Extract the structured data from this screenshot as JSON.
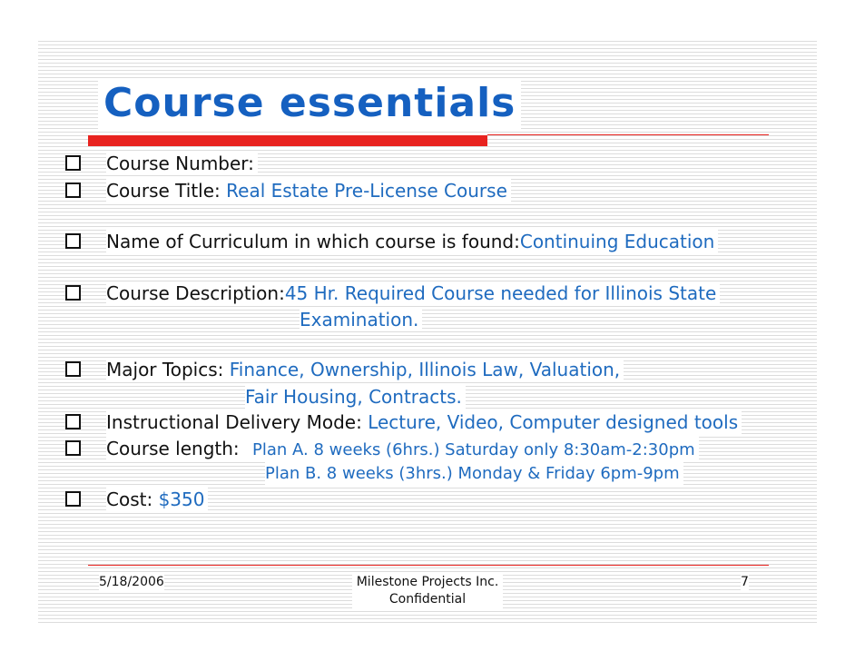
{
  "slide": {
    "title": "Course essentials",
    "items": {
      "course_number": {
        "label": "Course Number:",
        "value": ""
      },
      "course_title": {
        "label": "Course Title:",
        "value": "Real Estate Pre-License Course"
      },
      "curriculum": {
        "label": "Name of Curriculum in which course is found:",
        "value": "Continuing Education"
      },
      "description": {
        "label": "Course Description:",
        "value_line1": "45 Hr. Required Course needed for Illinois  State",
        "value_line2": "Examination."
      },
      "major_topics": {
        "label": "Major Topics:",
        "value_line1": "Finance, Ownership, Illinois Law, Valuation,",
        "value_line2": "Fair Housing, Contracts."
      },
      "delivery_mode": {
        "label": "Instructional Delivery Mode:",
        "value": "Lecture, Video, Computer designed tools"
      },
      "course_length": {
        "label": "Course length:",
        "plan_a": "Plan A. 8 weeks (6hrs.) Saturday only 8:30am-2:30pm",
        "plan_b": "Plan B. 8 weeks (3hrs.) Monday & Friday 6pm-9pm"
      },
      "cost": {
        "label": "Cost:",
        "value": "$350"
      }
    }
  },
  "footer": {
    "date": "5/18/2006",
    "company": "Milestone Projects Inc.",
    "confidential": "Confidential",
    "page_number": "7"
  },
  "colors": {
    "accent_red": "#e8231f",
    "value_blue": "#1f6bbf",
    "title_blue": "#1560c0"
  }
}
